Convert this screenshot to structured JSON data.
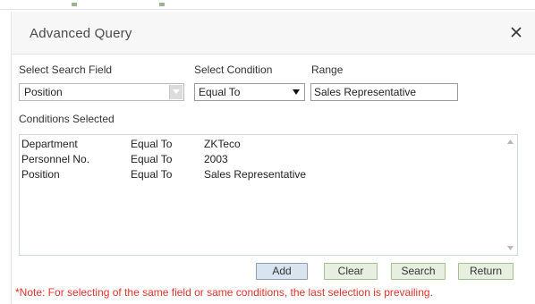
{
  "dialog": {
    "title": "Advanced Query",
    "close_icon": "close-icon"
  },
  "form": {
    "search_field_label": "Select Search Field",
    "search_field_value": "Position",
    "condition_label": "Select Condition",
    "condition_value": "Equal To",
    "range_label": "Range",
    "range_value": "Sales Representative"
  },
  "conditions": {
    "label": "Conditions Selected",
    "rows": [
      {
        "field": "Department",
        "condition": "Equal To",
        "value": "ZKTeco"
      },
      {
        "field": "Personnel No.",
        "condition": "Equal To",
        "value": "2003"
      },
      {
        "field": "Position",
        "condition": "Equal To",
        "value": "Sales Representative"
      }
    ]
  },
  "buttons": {
    "add": "Add",
    "clear": "Clear",
    "search": "Search",
    "return": "Return"
  },
  "note": "*Note: For selecting of the same field or same conditions, the last selection is prevailing.",
  "colors": {
    "note_text": "#e0332b",
    "add_button_bg": "#d8e4ef",
    "action_button_bg": "#e6efe0",
    "action_button_border": "#a4c08e"
  }
}
